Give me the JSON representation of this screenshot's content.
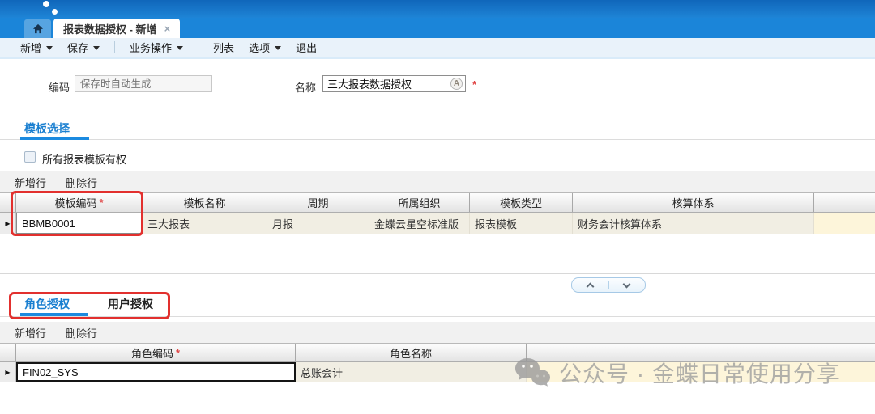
{
  "tabs": {
    "active": {
      "title": "报表数据授权 - 新增",
      "close_glyph": "×"
    }
  },
  "toolbar": {
    "items": [
      {
        "label": "新增",
        "dropdown": true
      },
      {
        "label": "保存",
        "dropdown": true
      },
      {
        "label": "业务操作",
        "dropdown": true
      },
      {
        "label": "列表",
        "dropdown": false
      },
      {
        "label": "选项",
        "dropdown": true
      },
      {
        "label": "退出",
        "dropdown": false
      }
    ]
  },
  "form": {
    "code_label": "编码",
    "code_placeholder": "保存时自动生成",
    "name_label": "名称",
    "name_value": "三大报表数据授权"
  },
  "marks": {
    "required": "*"
  },
  "icons": {
    "row_indicator": "▶",
    "translate_badge": "A"
  },
  "template_section": {
    "tab_label": "模板选择",
    "checkbox_label": "所有报表模板有权",
    "checkbox_checked": false,
    "toolbar": {
      "add_row": "新增行",
      "delete_row": "删除行"
    },
    "grid": {
      "columns": [
        "模板编码",
        "模板名称",
        "周期",
        "所属组织",
        "模板类型",
        "核算体系"
      ],
      "required_columns": [
        "模板编码"
      ],
      "rows": [
        [
          "BBMB0001",
          "三大报表",
          "月报",
          "金蝶云星空标准版",
          "报表模板",
          "财务会计核算体系"
        ]
      ]
    }
  },
  "auth_section": {
    "tabs": [
      {
        "label": "角色授权",
        "active": true
      },
      {
        "label": "用户授权",
        "active": false
      }
    ],
    "toolbar": {
      "add_row": "新增行",
      "delete_row": "删除行"
    },
    "grid": {
      "columns": [
        "角色编码",
        "角色名称"
      ],
      "required_columns": [
        "角色编码"
      ],
      "rows": [
        [
          "FIN02_SYS",
          "总账会计"
        ]
      ]
    }
  },
  "watermark": {
    "text": "公众号 · 金蝶日常使用分享"
  },
  "colors": {
    "brand_blue": "#1b85d9",
    "link_blue": "#1a7fd0",
    "annotation_red": "#e2302e",
    "row_beige": "#f1eee3",
    "row_cream": "#fdf5da",
    "toolbar_bg": "#e9f2fa"
  }
}
